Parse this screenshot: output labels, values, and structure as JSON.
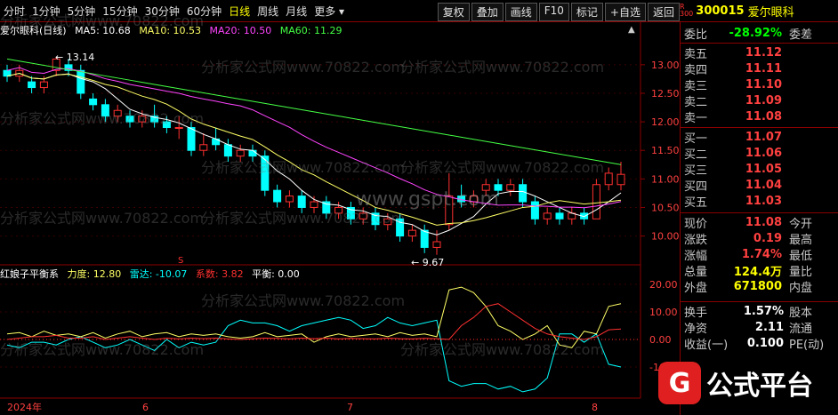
{
  "toolbar": {
    "periods": [
      "分时",
      "1分钟",
      "5分钟",
      "15分钟",
      "30分钟",
      "60分钟",
      "日线",
      "周线",
      "月线"
    ],
    "active_period": "日线",
    "more_label": "更多",
    "buttons": [
      "复权",
      "叠加",
      "画线",
      "F10",
      "标记",
      "+自选",
      "返回"
    ]
  },
  "stock": {
    "r_label": "R",
    "r_num": "300",
    "code": "300015",
    "name": "爱尔眼科"
  },
  "main_chart": {
    "title": "爱尔眼科(日线)",
    "ma5": "MA5: 10.68",
    "ma10": "MA10: 10.53",
    "ma20": "MA20: 10.50",
    "ma60": "MA60: 11.29",
    "high_mark": "13.14",
    "low_mark": "9.67",
    "y_ticks": [
      "13.00",
      "12.50",
      "12.00",
      "11.50",
      "11.00",
      "10.50",
      "10.00"
    ],
    "s_mark": "S"
  },
  "indicator": {
    "name": "红娘子平衡系",
    "li": "力度: 12.80",
    "lei": "雷达: -10.07",
    "xi": "系数: 3.82",
    "ping": "平衡: 0.00",
    "y_ticks": [
      "20.00",
      "10.00",
      "0.00",
      "-10.00"
    ]
  },
  "x_axis": {
    "labels": [
      "2024年",
      "6",
      "7",
      "8"
    ]
  },
  "quotes": {
    "weibi_label": "委比",
    "weibi_val": "-28.92%",
    "weicha_label": "委差",
    "asks": [
      {
        "label": "卖五",
        "price": "11.12"
      },
      {
        "label": "卖四",
        "price": "11.11"
      },
      {
        "label": "卖三",
        "price": "11.10"
      },
      {
        "label": "卖二",
        "price": "11.09"
      },
      {
        "label": "卖一",
        "price": "11.08"
      }
    ],
    "bids": [
      {
        "label": "买一",
        "price": "11.07"
      },
      {
        "label": "买二",
        "price": "11.06"
      },
      {
        "label": "买三",
        "price": "11.05"
      },
      {
        "label": "买四",
        "price": "11.04"
      },
      {
        "label": "买五",
        "price": "11.03"
      }
    ],
    "stats": [
      {
        "l": "现价",
        "v": "11.08",
        "r": "今开"
      },
      {
        "l": "涨跌",
        "v": "0.19",
        "r": "最高"
      },
      {
        "l": "涨幅",
        "v": "1.74%",
        "r": "最低"
      },
      {
        "l": "总量",
        "v": "124.4万",
        "r": "量比"
      },
      {
        "l": "外盘",
        "v": "671800",
        "r": "内盘"
      }
    ],
    "stats2": [
      {
        "l": "换手",
        "v": "1.57%",
        "r": "股本"
      },
      {
        "l": "净资",
        "v": "2.11",
        "r": "流通"
      },
      {
        "l": "收益(一)",
        "v": "0.100",
        "r": "PE(动)"
      }
    ]
  },
  "logo": {
    "mark": "G",
    "text": "公式平台"
  },
  "watermark": {
    "text": "分析家公式网www.70822.com",
    "site": "www.gspt.com"
  },
  "colors": {
    "up": "#ff3030",
    "down": "#00ffff",
    "ma5": "#ffffff",
    "ma10": "#ffff66",
    "ma20": "#ff44ff",
    "ma60": "#44ff44"
  }
}
